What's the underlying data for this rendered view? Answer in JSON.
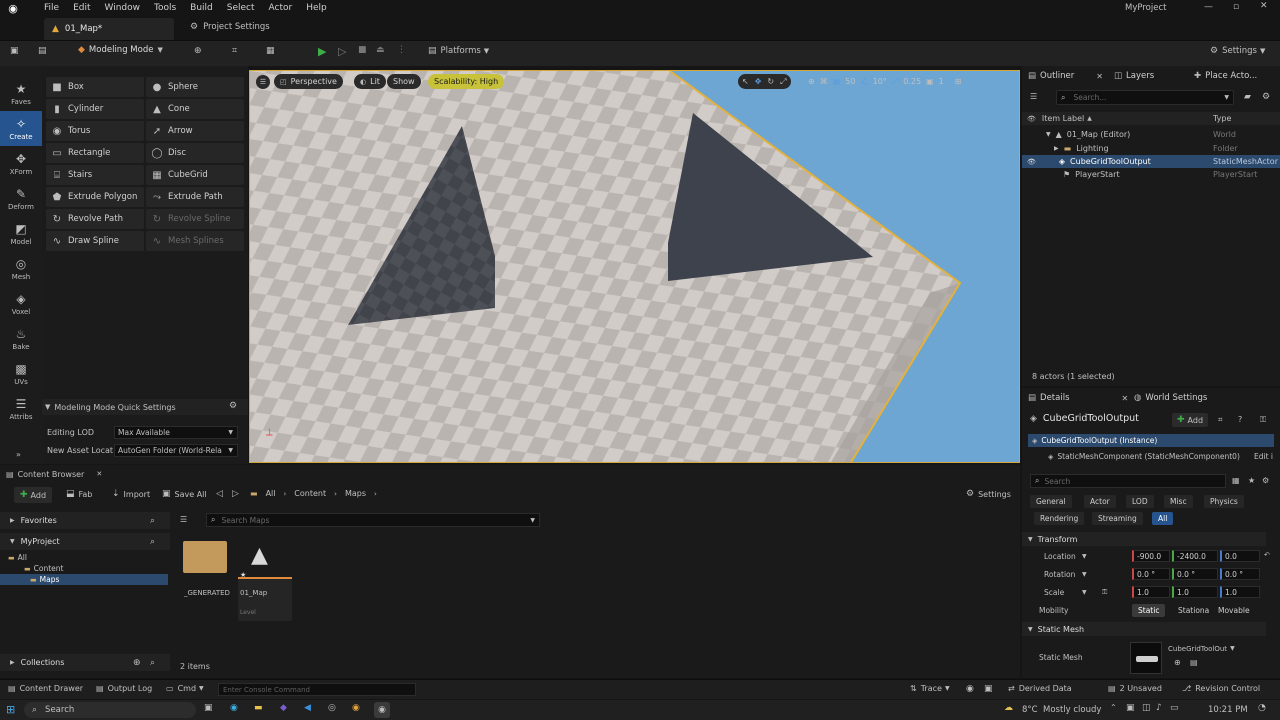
{
  "menu": [
    "File",
    "Edit",
    "Window",
    "Tools",
    "Build",
    "Select",
    "Actor",
    "Help"
  ],
  "project_name": "MyProject",
  "tabs": {
    "map": "01_Map*",
    "settings": "Project Settings"
  },
  "toolbar": {
    "mode": "Modeling Mode",
    "platforms": "Platforms",
    "settings": "Settings"
  },
  "modes": [
    "Faves",
    "Create",
    "XForm",
    "Deform",
    "Model",
    "Mesh",
    "Voxel",
    "Bake",
    "UVs",
    "Attribs"
  ],
  "palette": [
    "Box",
    "Sphere",
    "Cylinder",
    "Cone",
    "Torus",
    "Arrow",
    "Rectangle",
    "Disc",
    "Stairs",
    "CubeGrid",
    "Extrude Polygon",
    "Extrude Path",
    "Revolve Path",
    "Revolve Spline",
    "Draw Spline",
    "Mesh Splines"
  ],
  "quick_settings": {
    "title": "Modeling Mode Quick Settings",
    "lod_label": "Editing LOD",
    "lod_value": "Max Available",
    "asset_label": "New Asset Locat",
    "asset_value": "AutoGen Folder (World-Rela"
  },
  "viewport": {
    "perspective": "Perspective",
    "lit": "Lit",
    "show": "Show",
    "scalability": "Scalability: High",
    "grid": "50",
    "angle": "10°",
    "scale": "0.25",
    "cams": "1"
  },
  "outliner": {
    "tab": "Outliner",
    "layers": "Layers",
    "place": "Place Acto...",
    "search": "Search...",
    "col_label": "Item Label",
    "col_type": "Type",
    "rows": [
      {
        "label": "01_Map (Editor)",
        "type": "World"
      },
      {
        "label": "Lighting",
        "type": "Folder"
      },
      {
        "label": "CubeGridToolOutput",
        "type": "StaticMeshActor"
      },
      {
        "label": "PlayerStart",
        "type": "PlayerStart"
      }
    ],
    "count": "8 actors (1 selected)"
  },
  "details": {
    "tab": "Details",
    "world": "World Settings",
    "object": "CubeGridToolOutput",
    "add": "Add",
    "instance": "CubeGridToolOutput (Instance)",
    "component": "StaticMeshComponent (StaticMeshComponent0)",
    "edit": "Edit i",
    "search": "Search",
    "filters": [
      "General",
      "Actor",
      "LOD",
      "Misc",
      "Physics",
      "Rendering",
      "Streaming",
      "All"
    ],
    "transform": "Transform",
    "location": {
      "label": "Location",
      "x": "-900.0",
      "y": "-2400.0",
      "z": "0.0"
    },
    "rotation": {
      "label": "Rotation",
      "x": "0.0 °",
      "y": "0.0 °",
      "z": "0.0 °"
    },
    "scale": {
      "label": "Scale",
      "x": "1.0",
      "y": "1.0",
      "z": "1.0"
    },
    "mobility": {
      "label": "Mobility",
      "opts": [
        "Static",
        "Stationa",
        "Movable"
      ]
    },
    "static_mesh_section": "Static Mesh",
    "static_mesh_label": "Static Mesh",
    "static_mesh_value": "CubeGridToolOut"
  },
  "content_browser": {
    "tab": "Content Browser",
    "add": "Add",
    "fab": "Fab",
    "import": "Import",
    "save": "Save All",
    "crumbs": [
      "All",
      "Content",
      "Maps"
    ],
    "settings": "Settings",
    "favorites": "Favorites",
    "project": "MyProject",
    "tree": [
      "All",
      "Content",
      "Maps"
    ],
    "search": "Search Maps",
    "assets": [
      {
        "name": "_GENERATED"
      },
      {
        "name": "01_Map",
        "sub": "Level"
      }
    ],
    "collections": "Collections",
    "count": "2 items"
  },
  "statusbar": {
    "drawer": "Content Drawer",
    "log": "Output Log",
    "cmd": "Cmd",
    "console": "Enter Console Command",
    "trace": "Trace",
    "derived": "Derived Data",
    "unsaved": "2 Unsaved",
    "revision": "Revision Control"
  },
  "taskbar": {
    "search": "Search",
    "weather": "8°C  Mostly cloudy",
    "time": "10:21 PM"
  },
  "colors": {
    "accent": "#26548f",
    "selection": "#d3a83a",
    "sky": "#6da6d2",
    "play": "#3fae48"
  }
}
